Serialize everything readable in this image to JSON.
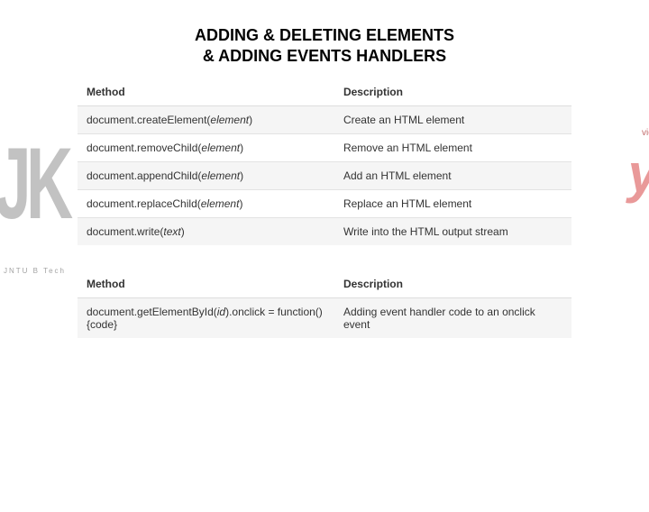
{
  "title_line1": "ADDING & DELETING ELEMENTS",
  "title_line2": "& ADDING EVENTS HANDLERS",
  "bg_left": "JK",
  "bg_left_small": "JNTU B Tech",
  "bg_right": "y!",
  "bg_right_dot": "vide.com",
  "table1": {
    "headers": [
      "Method",
      "Description"
    ],
    "rows": [
      {
        "method_pre": "document.createElement(",
        "param": "element",
        "method_post": ")",
        "desc": "Create an HTML element"
      },
      {
        "method_pre": "document.removeChild(",
        "param": "element",
        "method_post": ")",
        "desc": "Remove an HTML element"
      },
      {
        "method_pre": "document.appendChild(",
        "param": "element",
        "method_post": ")",
        "desc": "Add an HTML element"
      },
      {
        "method_pre": "document.replaceChild(",
        "param": "element",
        "method_post": ")",
        "desc": "Replace an HTML element"
      },
      {
        "method_pre": "document.write(",
        "param": "text",
        "method_post": ")",
        "desc": "Write into the HTML output stream"
      }
    ]
  },
  "table2": {
    "headers": [
      "Method",
      "Description"
    ],
    "rows": [
      {
        "method_pre": "document.getElementById(",
        "param": "id",
        "method_post": ").onclick = function(){code}",
        "desc": "Adding event handler code to an onclick event"
      }
    ]
  }
}
